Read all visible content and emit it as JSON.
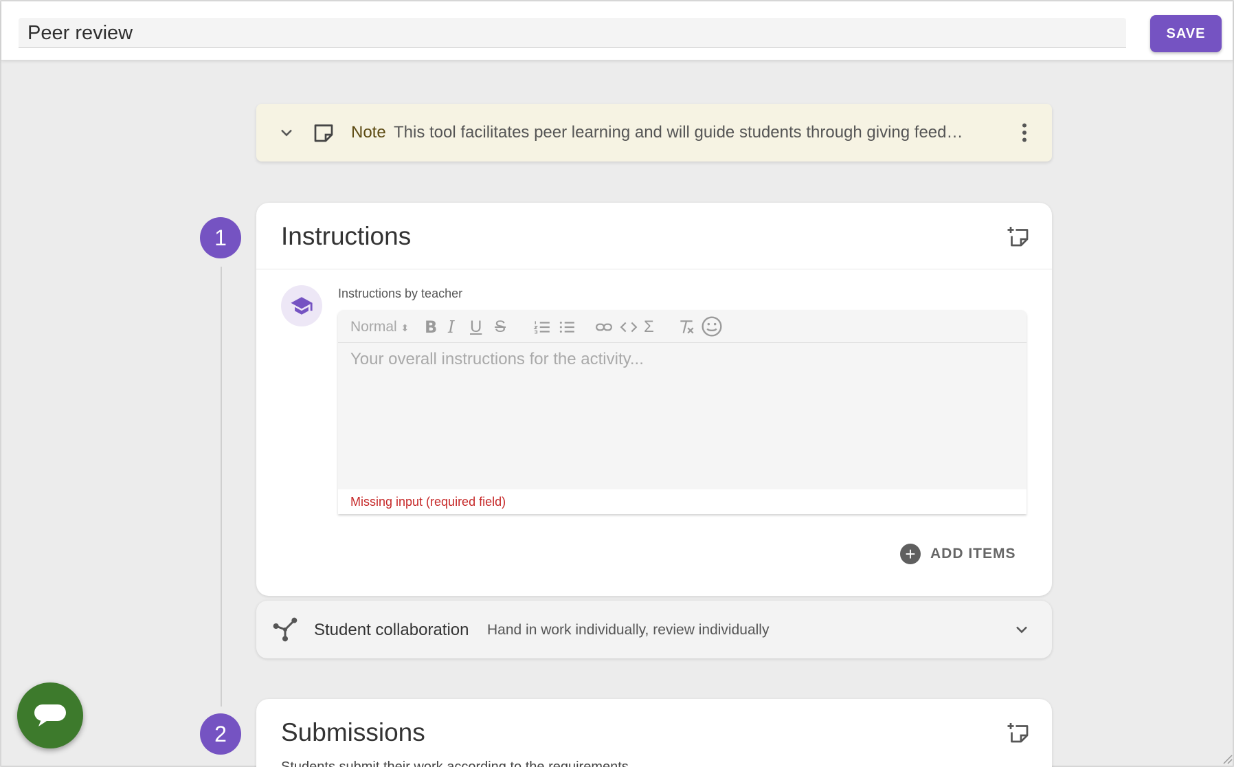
{
  "header": {
    "title_value": "Peer review",
    "save_label": "SAVE"
  },
  "note": {
    "label": "Note",
    "text": "This tool facilitates peer learning and will guide students through giving feedba..."
  },
  "steps": [
    {
      "number": "1",
      "title": "Instructions",
      "field_label": "Instructions by teacher",
      "toolbar": {
        "format": "Normal"
      },
      "editor_placeholder": "Your overall instructions for the activity...",
      "error": "Missing input (required field)",
      "add_items_label": "ADD ITEMS"
    },
    {
      "number": "2",
      "title": "Submissions",
      "subtitle": "Students submit their work according to the requirements."
    }
  ],
  "collaboration": {
    "title": "Student collaboration",
    "value": "Hand in work individually, review individually"
  },
  "colors": {
    "accent": "#7553c2",
    "note_bg": "#f6f3e3",
    "error": "#c62828",
    "chat_fab": "#3d7a2c"
  },
  "icons": [
    "chevron-down-icon",
    "note-icon",
    "more-vert-icon",
    "add-note-icon",
    "graduation-cap-icon",
    "plus-circle-icon",
    "collaboration-icon",
    "chat-icon"
  ]
}
